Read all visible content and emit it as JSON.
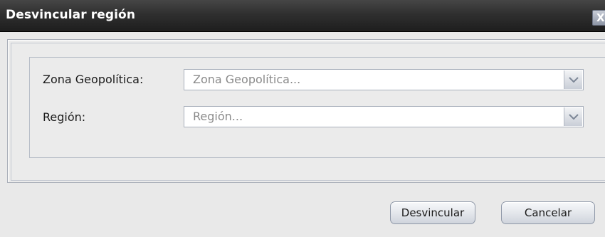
{
  "window": {
    "title": "Desvincular región",
    "close_glyph": "X"
  },
  "form": {
    "fields": [
      {
        "label": "Zona Geopolítica:",
        "placeholder": "Zona Geopolítica..."
      },
      {
        "label": "Región:",
        "placeholder": "Región..."
      }
    ]
  },
  "buttons": {
    "unlink_label": "Desvincular",
    "cancel_label": "Cancelar"
  },
  "icons": {
    "close": "close-icon",
    "dropdown": "chevron-down-icon"
  },
  "colors": {
    "titlebar": "#2f2f2f",
    "title_text": "#ffffff",
    "background": "#e9e9e9",
    "placeholder_text": "#8a8a8a"
  }
}
